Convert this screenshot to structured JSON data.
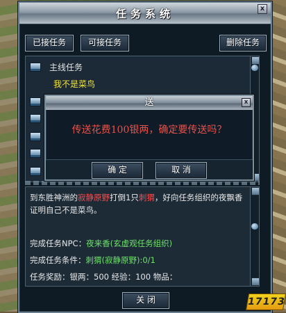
{
  "window": {
    "title": "任务系统"
  },
  "tabs": {
    "accepted": "已接任务",
    "available": "可接任务",
    "delete": "删除任务"
  },
  "list": {
    "section": "主线任务",
    "quest": "我不是菜鸟"
  },
  "dialog": {
    "title": "送",
    "message": "传送花费100银两，确定要传送吗？",
    "ok": "确 定",
    "cancel": "取 消"
  },
  "detail": {
    "desc_1": "到东胜神洲的",
    "desc_place": "寂静原野",
    "desc_2": "打倒1只",
    "desc_monster": "刺猬",
    "desc_3": "，好向任务组织的夜飘香证明自己不是菜鸟。",
    "npc_label": "完成任务NPC：",
    "npc_value": "夜来香(玄虚观任务组织)",
    "cond_label": "完成任务条件：",
    "cond_value": "刺猬(寂静原野):0/1",
    "reward": "任务奖励：银两：500    经验：100    物品："
  },
  "footer": {
    "close": "关 闭"
  },
  "watermark": "17173",
  "colors": {
    "quest_yellow": "#f2e43a",
    "red": "#ff4a4a",
    "green": "#6fe26b",
    "dialog_text": "#e8514a"
  }
}
